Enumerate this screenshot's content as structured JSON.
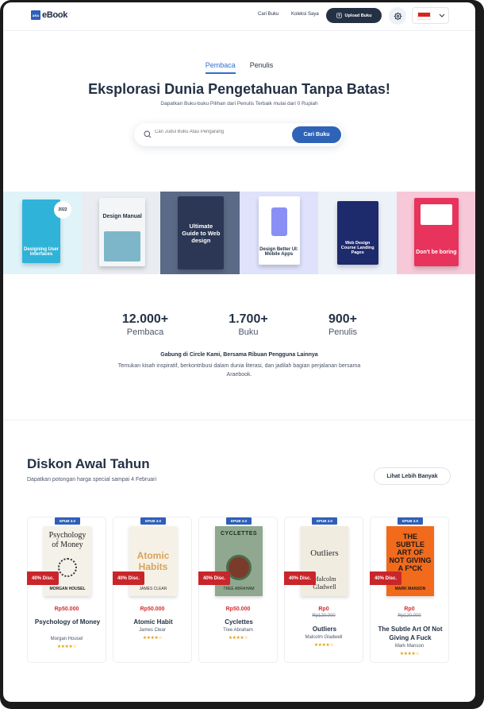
{
  "nav": {
    "logo_mark": "ARA",
    "logo_text": "eBook",
    "links": [
      "Cari Buku",
      "Koleksi Saya"
    ],
    "upload_label": "Upload Buku",
    "language": "id"
  },
  "hero": {
    "tabs": [
      "Pembaca",
      "Penulis"
    ],
    "active_tab": "Pembaca",
    "title": "Eksplorasi Dunia Pengetahuan Tanpa Batas!",
    "subtitle": "Dapatkan Buku-buku Pilihan dari Penulis Terbaik mulai dari 0 Rupiah",
    "search_placeholder": "Cari Judul Buku Atau Pengarang",
    "search_button": "Cari Buku"
  },
  "banner": {
    "covers": [
      {
        "title": "Designing User Interfaces",
        "badge": "2022",
        "bg": "#dff3f8",
        "book": "#2fb3d9"
      },
      {
        "title": "Design Manual",
        "bg": "#e9edf2",
        "book": "#f3f5f7"
      },
      {
        "title": "Ultimate Guide to Web design",
        "bg": "#5b6a86",
        "book": "#2b3755"
      },
      {
        "title": "Design Better UI: Mobile Apps",
        "bg": "#dfe2fb",
        "book": "#ffffff"
      },
      {
        "title": "Web Design Course Landing Pages",
        "bg": "#edf1f8",
        "book": "#1d2a6b"
      },
      {
        "title": "Don't be boring",
        "bg": "#f7c9d8",
        "book": "#e8335d"
      }
    ]
  },
  "stats": [
    {
      "value": "12.000+",
      "label": "Pembaca"
    },
    {
      "value": "1.700+",
      "label": "Buku"
    },
    {
      "value": "900+",
      "label": "Penulis"
    }
  ],
  "join": {
    "title": "Gabung di Circle Kami, Bersama Ribuan Pengguna Lainnya",
    "description": "Temukan kisah inspiratif, berkontribusi dalam dunia literasi, dan jadilah bagian perjalanan bersama Araebook."
  },
  "discount": {
    "title": "Diskon Awal Tahun",
    "subtitle": "Dapatkan potongan harga special sampai 4 Februari",
    "more_button": "Lihat Lebih Banyak",
    "books": [
      {
        "format": "EPUB 3.0",
        "badge": "40% Disc.",
        "price": "Rp50.000",
        "old_price": "",
        "title": "Psychology of Money",
        "author": "Morgan Housel",
        "stars": "★★★★☆",
        "cover_title": "Psychology of Money",
        "cover_author": "MORGAN HOUSEL",
        "cover_bg": "#f4f1e9",
        "cover_fg": "#222222"
      },
      {
        "format": "EPUB 3.0",
        "badge": "40% Disc.",
        "price": "Rp50.000",
        "old_price": "",
        "title": "Atomic Habit",
        "author": "James Clear",
        "stars": "★★★★☆",
        "cover_title": "Atomic Habits",
        "cover_author": "JAMES CLEAR",
        "cover_bg": "#f6f1e6",
        "cover_fg": "#d9a25a"
      },
      {
        "format": "EPUB 3.0",
        "badge": "40% Disc.",
        "price": "Rp50.000",
        "old_price": "",
        "title": "Cyclettes",
        "author": "Tree Abraham",
        "stars": "★★★★☆",
        "cover_title": "CYCLETTES",
        "cover_author": "TREE ABRAHAM",
        "cover_bg": "#8fa88f",
        "cover_fg": "#1f2a1f"
      },
      {
        "format": "EPUB 3.0",
        "badge": "40% Disc.",
        "price": "Rp0",
        "old_price": "Rp120.000",
        "title": "Outliers",
        "author": "Malcolm Gladwell",
        "stars": "★★★★☆",
        "cover_title": "Outliers",
        "cover_author": "Malcolm Gladwell",
        "cover_bg": "#f1ece0",
        "cover_fg": "#2b2b2b"
      },
      {
        "format": "EPUB 3.0",
        "badge": "40% Disc.",
        "price": "Rp0",
        "old_price": "Rp120.000",
        "title": "The Subtle Art Of Not Giving A Fuck",
        "author": "Mark Manson",
        "stars": "★★★★☆",
        "cover_title": "THE SUBTLE ART OF NOT GIVING A F*CK",
        "cover_author": "MARK MANSON",
        "cover_bg": "#f26a1b",
        "cover_fg": "#1a1a1a"
      }
    ]
  },
  "colors": {
    "primary": "#2f63b7",
    "dark": "#243145",
    "discount": "#c8262b",
    "star": "#e3a21a"
  }
}
